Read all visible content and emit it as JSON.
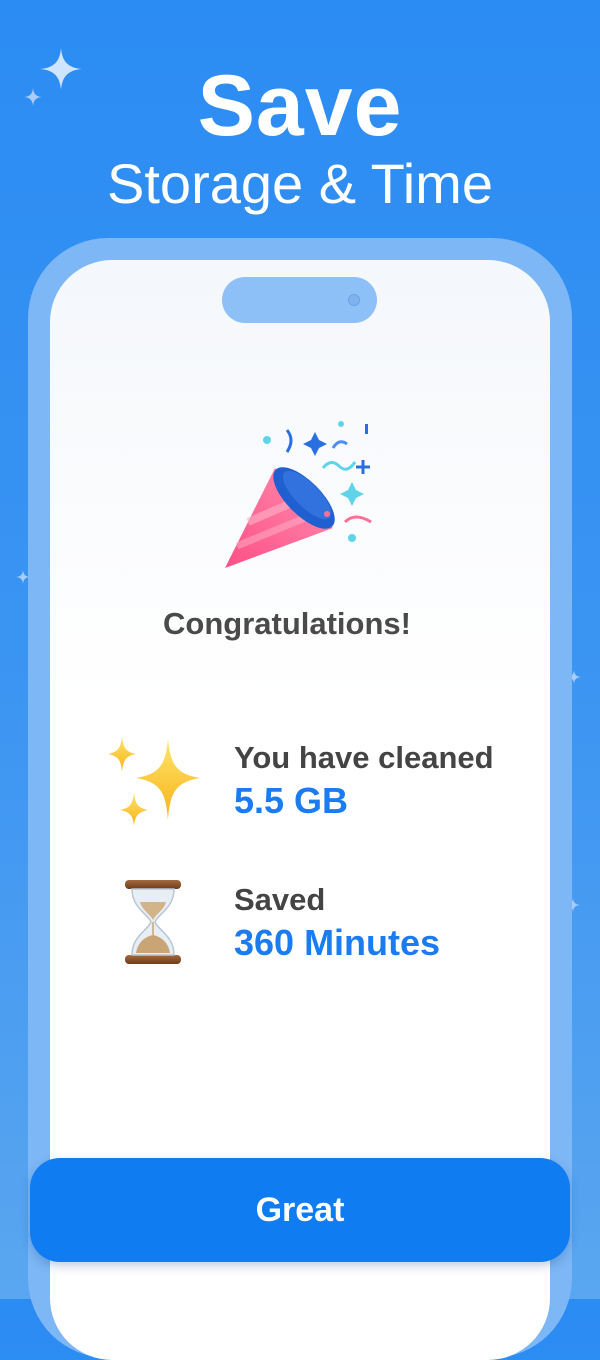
{
  "header": {
    "title": "Save",
    "subtitle": "Storage & Time"
  },
  "celebration": {
    "icon": "party-popper-icon",
    "message": "Congratulations!"
  },
  "stats": [
    {
      "icon": "sparkles-icon",
      "label": "You have cleaned",
      "value": "5.5 GB"
    },
    {
      "icon": "hourglass-icon",
      "label": "Saved",
      "value": "360 Minutes"
    }
  ],
  "actions": {
    "primary_label": "Great"
  },
  "colors": {
    "background": "#2b8cf3",
    "accent": "#1a7cf0",
    "button": "#0f7cf2"
  }
}
